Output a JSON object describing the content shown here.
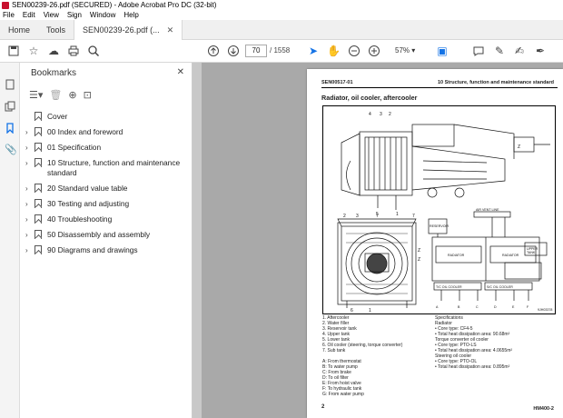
{
  "window": {
    "title": "SEN00239-26.pdf (SECURED) - Adobe Acrobat Pro DC (32-bit)"
  },
  "menu": [
    "File",
    "Edit",
    "View",
    "Sign",
    "Window",
    "Help"
  ],
  "tabs": {
    "home": "Home",
    "tools": "Tools",
    "document": "SEN00239-26.pdf (..."
  },
  "toolbar": {
    "page_current": "70",
    "page_total": "/ 1558",
    "zoom": "57%"
  },
  "bookmarks": {
    "title": "Bookmarks",
    "items": [
      {
        "label": "Cover",
        "expandable": false
      },
      {
        "label": "00 Index and foreword",
        "expandable": true
      },
      {
        "label": "01 Specification",
        "expandable": true
      },
      {
        "label": "10 Structure, function and maintenance standard",
        "expandable": true
      },
      {
        "label": "20 Standard value table",
        "expandable": true
      },
      {
        "label": "30 Testing and adjusting",
        "expandable": true
      },
      {
        "label": "40 Troubleshooting",
        "expandable": true
      },
      {
        "label": "50 Disassembly and assembly",
        "expandable": true
      },
      {
        "label": "90 Diagrams and drawings",
        "expandable": true
      }
    ]
  },
  "page": {
    "header_left": "SEN00517-01",
    "header_right": "10 Structure, function and maintenance standard",
    "title": "Radiator, oil cooler, aftercooler",
    "figure_code": "9JH03378",
    "legend_left": [
      "1.   Aftercooler",
      "2.   Water filler",
      "3.   Reservoir tank",
      "4.   Upper tank",
      "5.   Lower tank",
      "6.   Oil cooler (steering, torque converter)",
      "7.   Sub tank",
      "",
      "A:   From thermostat",
      "B:   To water pump",
      "C:   From brake",
      "D:   To oil filter",
      "E:   From hoist valve",
      "F:   To hydraulic tank",
      "G:   From water pump"
    ],
    "legend_right": [
      "Specifications",
      "Radiator",
      "  •  Core type: CF4-5",
      "  •  Total heat dissipation area: 90.68m²",
      "Torque converter oil cooler",
      "  •  Core type: PTO-LS",
      "  •  Total heat dissipation area: 4.0655m²",
      "Steering oil cooler",
      "  •  Core type: PTO-OL",
      "  •  Total heat dissipation area: 0.895m²"
    ],
    "footer_left": "2",
    "footer_right": "HM400-2"
  }
}
